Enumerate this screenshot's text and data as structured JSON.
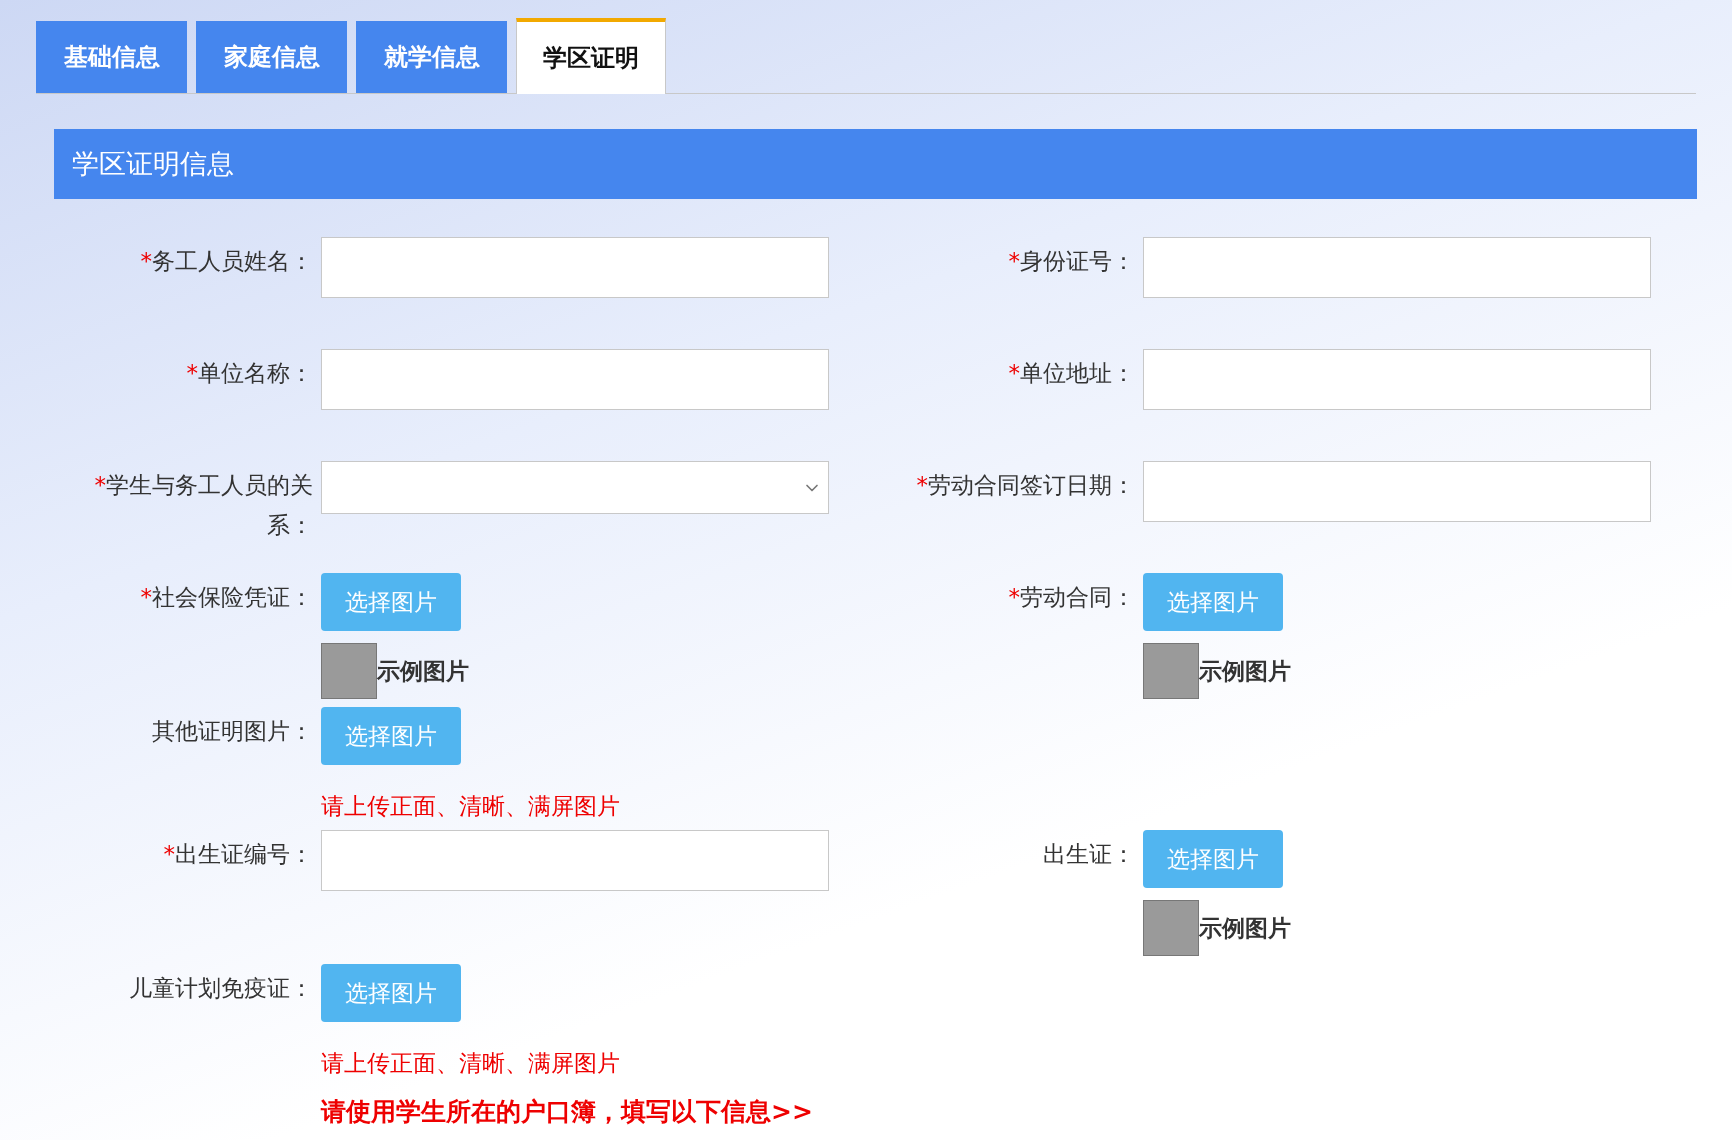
{
  "tabs": [
    {
      "label": "基础信息",
      "selected": false
    },
    {
      "label": "家庭信息",
      "selected": false
    },
    {
      "label": "就学信息",
      "selected": false
    },
    {
      "label": "学区证明",
      "selected": true
    }
  ],
  "section_title": "学区证明信息",
  "rows": [
    {
      "left": {
        "kind": "text",
        "required_mark": "*",
        "label": "务工人员姓名："
      },
      "right": {
        "kind": "text",
        "required_mark": "*",
        "label": "身份证号："
      }
    },
    {
      "left": {
        "kind": "text",
        "required_mark": "*",
        "label": "单位名称："
      },
      "right": {
        "kind": "text",
        "required_mark": "*",
        "label": "单位地址："
      }
    },
    {
      "left": {
        "kind": "select",
        "required_mark": "*",
        "label": "学生与务工人员的关系："
      },
      "right": {
        "kind": "text",
        "required_mark": "*",
        "label": "劳动合同签订日期："
      }
    },
    {
      "left": {
        "kind": "upload",
        "required_mark": "*",
        "label": "社会保险凭证：",
        "button": "选择图片",
        "sample": "示例图片"
      },
      "right": {
        "kind": "upload",
        "required_mark": "*",
        "label": "劳动合同：",
        "button": "选择图片",
        "sample": "示例图片"
      }
    },
    {
      "left": {
        "kind": "upload",
        "label": "其他证明图片：",
        "button": "选择图片",
        "hint": "请上传正面、清晰、满屏图片"
      }
    },
    {
      "left": {
        "kind": "text",
        "required_mark": "*",
        "label": "出生证编号："
      },
      "right": {
        "kind": "upload",
        "label": "出生证：",
        "button": "选择图片",
        "sample": "示例图片"
      }
    },
    {
      "left": {
        "kind": "upload",
        "label": "儿童计划免疫证：",
        "button": "选择图片",
        "hint": "请上传正面、清晰、满屏图片"
      }
    }
  ],
  "notice": "请使用学生所在的户口簿，填写以下信息>>"
}
